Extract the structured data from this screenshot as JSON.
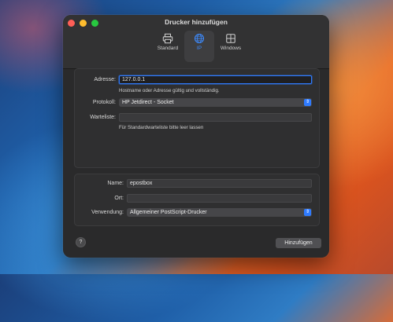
{
  "window": {
    "title": "Drucker hinzufügen"
  },
  "toolbar": {
    "items": [
      {
        "label": "Standard",
        "icon": "printer-icon",
        "active": false
      },
      {
        "label": "IP",
        "icon": "globe-icon",
        "active": true
      },
      {
        "label": "Windows",
        "icon": "windows-icon",
        "active": false
      }
    ]
  },
  "form": {
    "address_label": "Adresse:",
    "address_value": "127.0.0.1",
    "address_hint": "Hostname oder Adresse gültig und vollständig.",
    "protocol_label": "Protokoll:",
    "protocol_value": "HP Jetdirect - Socket",
    "queue_label": "Warteliste:",
    "queue_value": "",
    "queue_hint": "Für Standardwarteliste bitte leer lassen",
    "name_label": "Name:",
    "name_value": "epostbox",
    "location_label": "Ort:",
    "location_value": "",
    "usage_label": "Verwendung:",
    "usage_value": "Allgemeiner PostScript-Drucker"
  },
  "footer": {
    "help_label": "?",
    "add_label": "Hinzufügen"
  },
  "colors": {
    "accent": "#2f7bff",
    "window_bg": "#2a2a2b"
  }
}
